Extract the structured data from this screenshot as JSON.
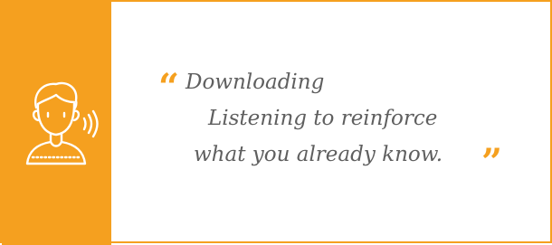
{
  "colors": {
    "accent": "#F5A01F",
    "text": "#5f5f5f",
    "background": "#ffffff"
  },
  "icon": {
    "name": "listener-sound-icon"
  },
  "quote": {
    "open_mark": "“",
    "close_mark": "”",
    "lines": [
      "Downloading",
      "Listening to reinforce",
      "what you already know."
    ]
  }
}
